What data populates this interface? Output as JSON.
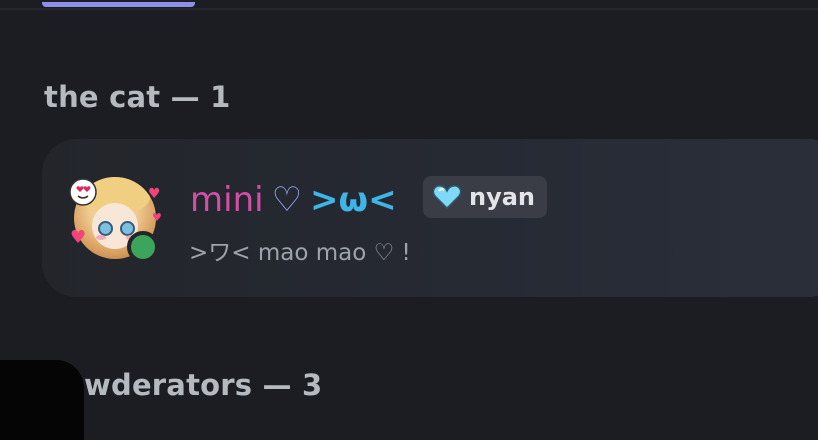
{
  "sections": [
    {
      "title": "the cat — 1"
    },
    {
      "title": "eowderators — 3"
    }
  ],
  "member": {
    "name": "mini",
    "name_heart": "♡",
    "name_face": ">ω<",
    "tag_label": "nyan",
    "tag_icon": "cyan-heart-icon",
    "status": ">ワ< mao mao ♡ !",
    "presence": "online",
    "colors": {
      "name": "#d14fa6",
      "face": "#3fb4e6",
      "online": "#3ba55c"
    }
  },
  "colors": {
    "accent": "#8c90e8",
    "background": "#1c1d22",
    "card": "#262a33"
  }
}
